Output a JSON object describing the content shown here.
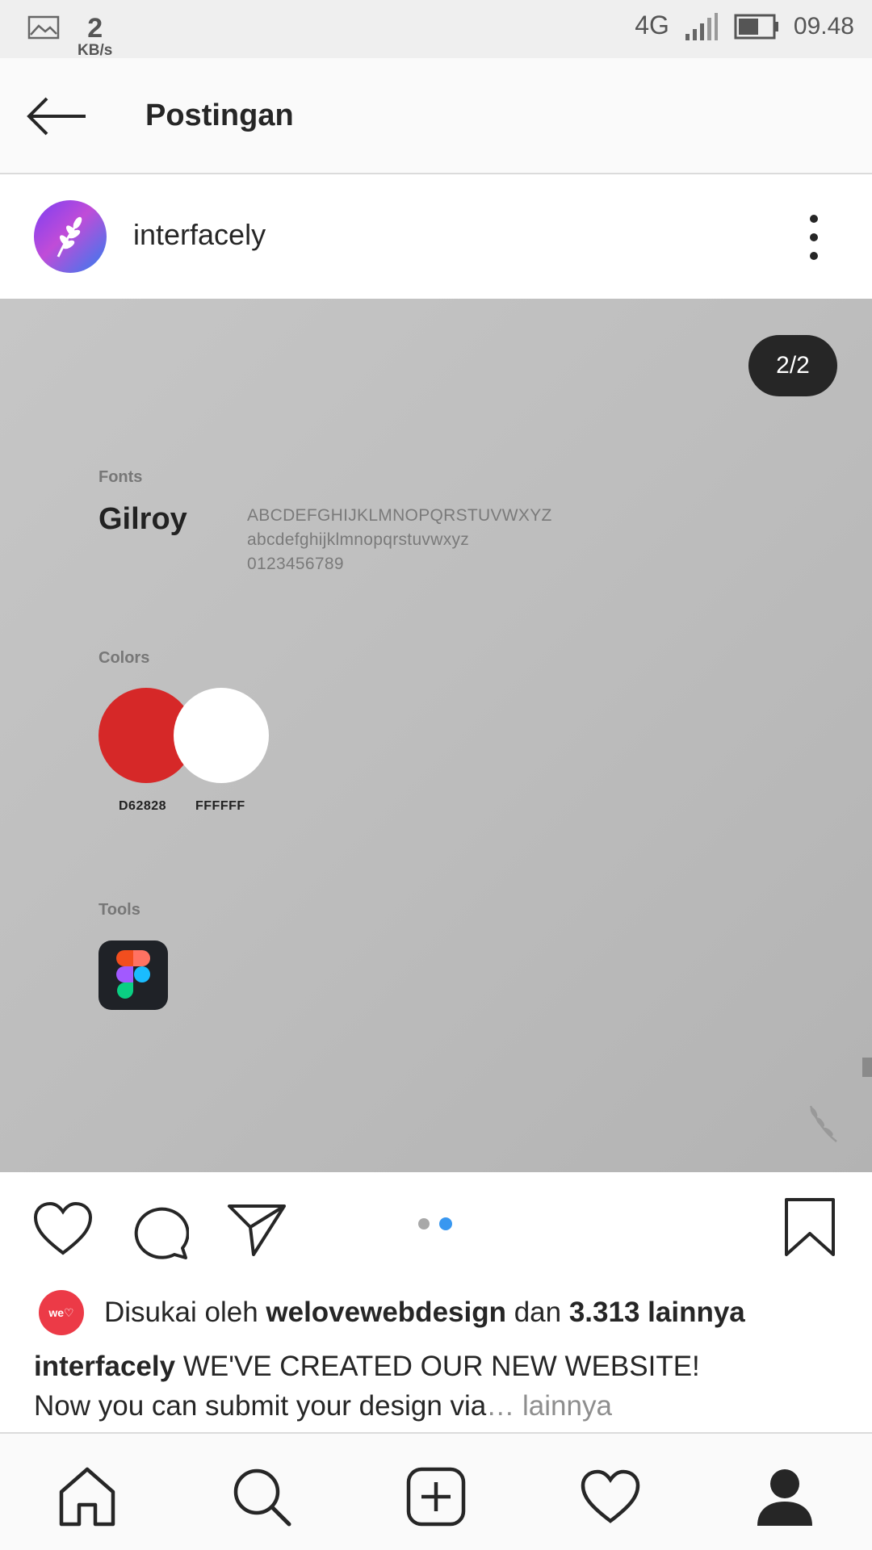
{
  "status_bar": {
    "speed_value": "2",
    "speed_unit": "KB/s",
    "network": "4G",
    "time": "09.48",
    "icons": [
      "image-icon",
      "signal-icon",
      "battery-icon"
    ]
  },
  "top_bar": {
    "title": "Postingan",
    "back_icon": "arrow-left-icon"
  },
  "post": {
    "username": "interfacely",
    "avatar_icon": "laurel-icon",
    "more_icon": "more-vertical-icon",
    "counter": "2/2",
    "media": {
      "fonts_label": "Fonts",
      "font_name": "Gilroy",
      "uppercase": "ABCDEFGHIJKLMNOPQRSTUVWXYZ",
      "lowercase": "abcdefghijklmnopqrstuvwxyz",
      "digits": "0123456789",
      "colors_label": "Colors",
      "colors": [
        {
          "hex": "#D62828",
          "label": "D62828"
        },
        {
          "hex": "#FFFFFF",
          "label": "FFFFFF"
        }
      ],
      "tools_label": "Tools",
      "tool_icon": "figma-icon"
    },
    "actions": {
      "like_icon": "heart-icon",
      "comment_icon": "comment-icon",
      "share_icon": "send-icon",
      "save_icon": "bookmark-icon",
      "pages_total": 2,
      "page_active": 2
    },
    "likes": {
      "avatar_text": "we♡",
      "prefix": "Disukai oleh ",
      "user": "welovewebdesign",
      "middle": " dan ",
      "count": "3.313 lainnya"
    },
    "caption": {
      "user": "interfacely",
      "text": " WE'VE CREATED OUR NEW WEBSITE!",
      "line2": "Now you can submit your design via",
      "more": "… lainnya"
    }
  },
  "bottom_nav": {
    "items": [
      "home-icon",
      "search-icon",
      "add-post-icon",
      "activity-heart-icon",
      "profile-icon"
    ]
  },
  "colors": {
    "accent_blue": "#3897f0",
    "brand_red": "#D62828"
  }
}
